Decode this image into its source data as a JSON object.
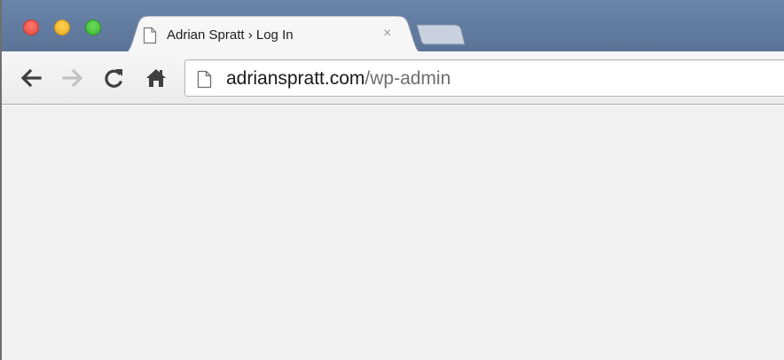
{
  "window": {
    "controls": [
      "close",
      "minimize",
      "maximize"
    ]
  },
  "tabs": [
    {
      "title": "Adrian Spratt › Log In",
      "close_glyph": "×",
      "icon": "page-icon",
      "active": true
    }
  ],
  "new_tab": {
    "icon": "new-tab-icon"
  },
  "toolbar": {
    "buttons": [
      {
        "name": "back",
        "icon": "arrow-left-icon",
        "enabled": true
      },
      {
        "name": "forward",
        "icon": "arrow-right-icon",
        "enabled": false
      },
      {
        "name": "reload",
        "icon": "reload-icon",
        "enabled": true
      },
      {
        "name": "home",
        "icon": "home-icon",
        "enabled": true
      }
    ]
  },
  "omnibox": {
    "icon": "page-icon",
    "url_domain": "adrianspratt.com",
    "url_path": "/wp-admin"
  },
  "colors": {
    "titlebar": "#5b7397",
    "toolbar": "#f0f0f0",
    "content": "#f1f1f1"
  }
}
